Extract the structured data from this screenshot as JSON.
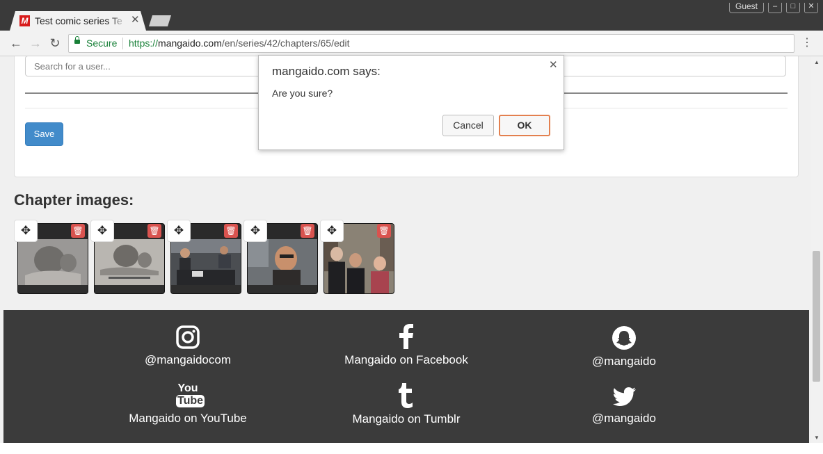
{
  "browser": {
    "tab_title": "Test comic series Te",
    "tab_favicon_letter": "M",
    "guest_label": "Guest",
    "secure_label": "Secure",
    "url_scheme": "https://",
    "url_host": "mangaido.com",
    "url_path": "/en/series/42/chapters/65/edit"
  },
  "form": {
    "search_placeholder": "Search for a user...",
    "save_label": "Save"
  },
  "chapter": {
    "heading": "Chapter images:",
    "images": [
      {
        "subject": "sketch drawing"
      },
      {
        "subject": "sketch drawing with caption"
      },
      {
        "subject": "people at desk"
      },
      {
        "subject": "selfie man"
      },
      {
        "subject": "group selfie street"
      }
    ]
  },
  "footer": {
    "links": [
      {
        "icon": "instagram-icon",
        "label": "@mangaidocom"
      },
      {
        "icon": "facebook-icon",
        "label": "Mangaido on Facebook"
      },
      {
        "icon": "snapchat-icon",
        "label": "@mangaido"
      },
      {
        "icon": "youtube-icon",
        "label": "Mangaido on YouTube"
      },
      {
        "icon": "tumblr-icon",
        "label": "Mangaido on Tumblr"
      },
      {
        "icon": "twitter-icon",
        "label": "@mangaido"
      }
    ],
    "youtube_text_top": "You",
    "youtube_text_bottom": "Tube"
  },
  "dialog": {
    "title": "mangaido.com says:",
    "message": "Are you sure?",
    "cancel_label": "Cancel",
    "ok_label": "OK"
  },
  "colors": {
    "primary_button": "#428bca",
    "delete_button": "#d9534f",
    "footer_bg": "#3b3b3b",
    "ok_focus": "#e3804f",
    "secure_green": "#188038"
  }
}
